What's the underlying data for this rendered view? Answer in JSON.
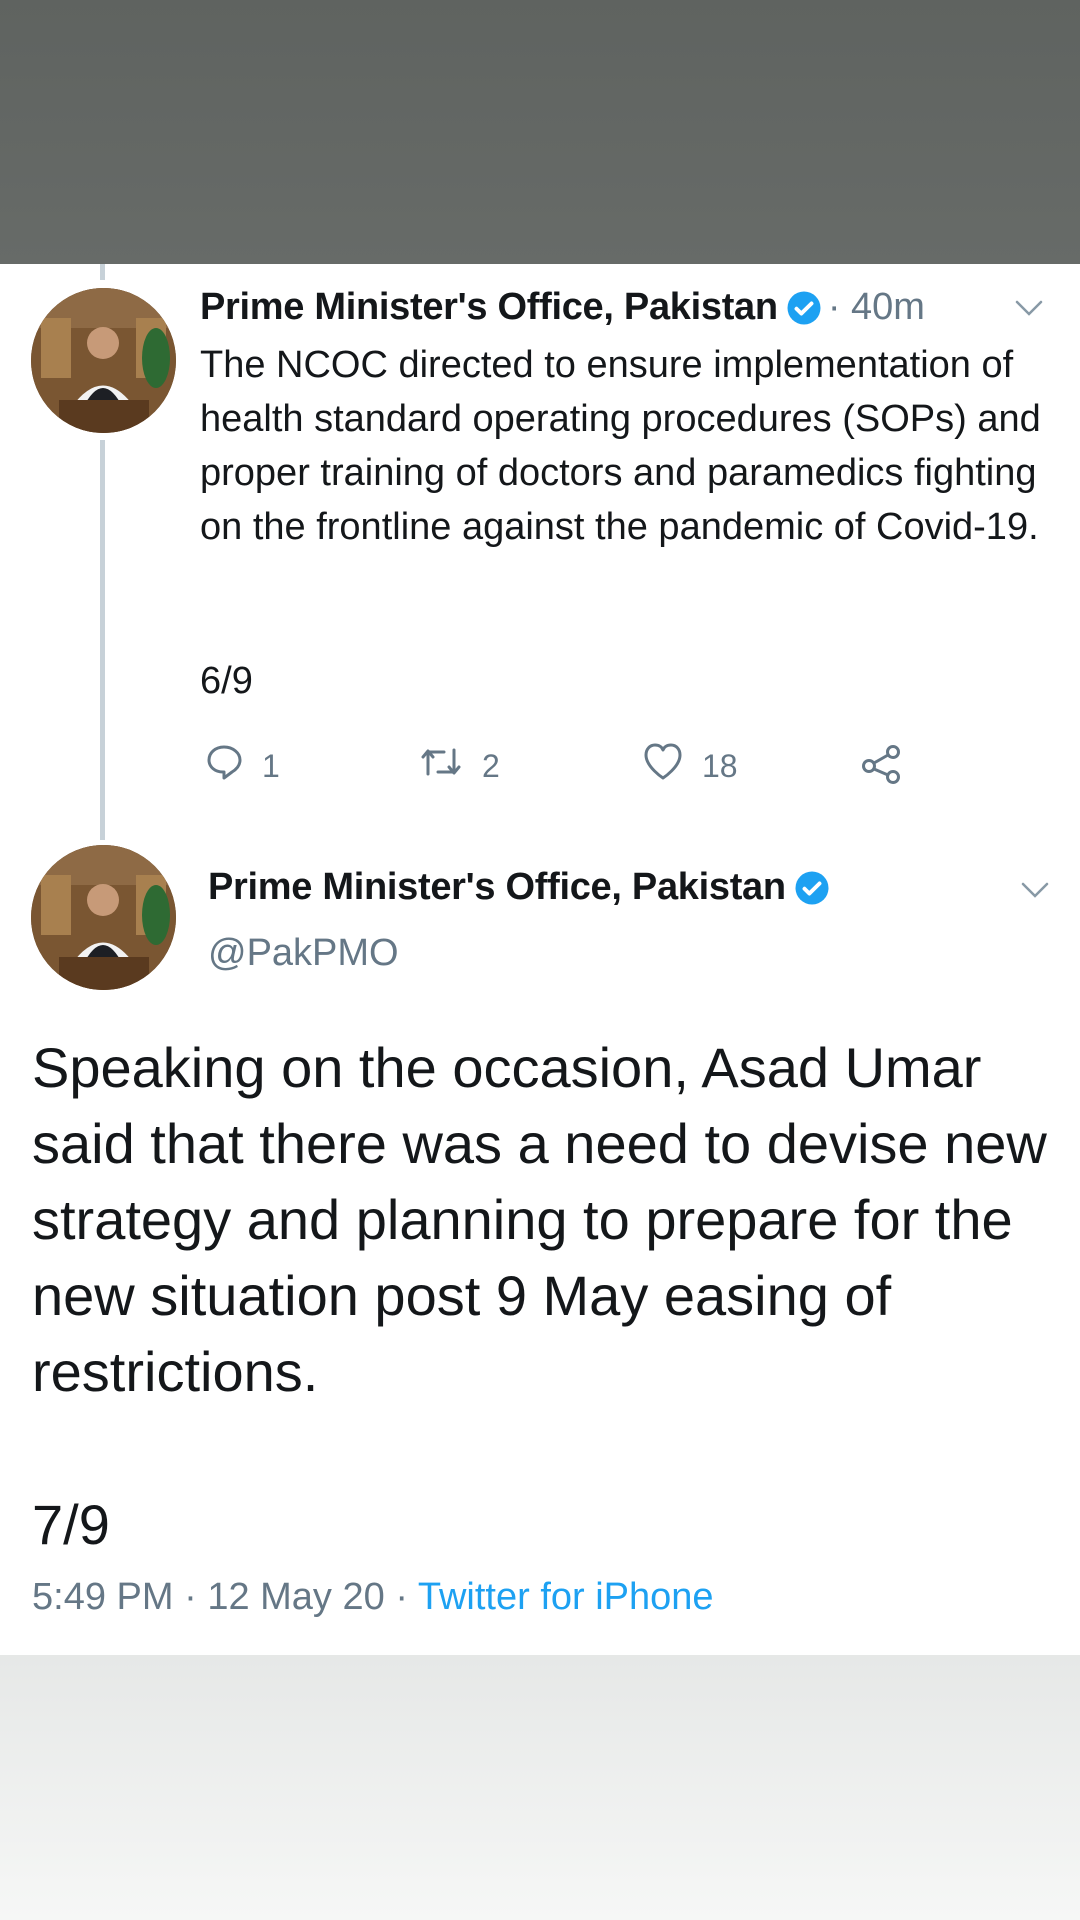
{
  "tweet1": {
    "author_name": "Prime Minister's Office, Pakistan",
    "time_ago": "· 40m",
    "text": "The NCOC directed to ensure implementation of health standard operating procedures (SOPs) and proper training of doctors and paramedics fighting on the frontline against the pandemic of Covid-19.",
    "counter": "6/9",
    "actions": {
      "reply_count": "1",
      "retweet_count": "2",
      "like_count": "18"
    }
  },
  "tweet2": {
    "author_name": "Prime Minister's Office, Pakistan",
    "handle": "@PakPMO",
    "text": "Speaking on the occasion, Asad Umar said that there was a need to devise new strategy and planning to prepare for the new situation post 9 May easing of restrictions.",
    "counter": "7/9",
    "time": "5:49 PM",
    "date": "12 May 20",
    "separator": "·",
    "source": "Twitter for iPhone"
  },
  "colors": {
    "accent": "#1da1f2",
    "muted": "#657786",
    "text": "#14171a",
    "thread_line": "#c7d1d8"
  },
  "icons": [
    "verified-badge-icon",
    "chevron-down-icon",
    "reply-icon",
    "retweet-icon",
    "like-icon",
    "share-icon"
  ]
}
